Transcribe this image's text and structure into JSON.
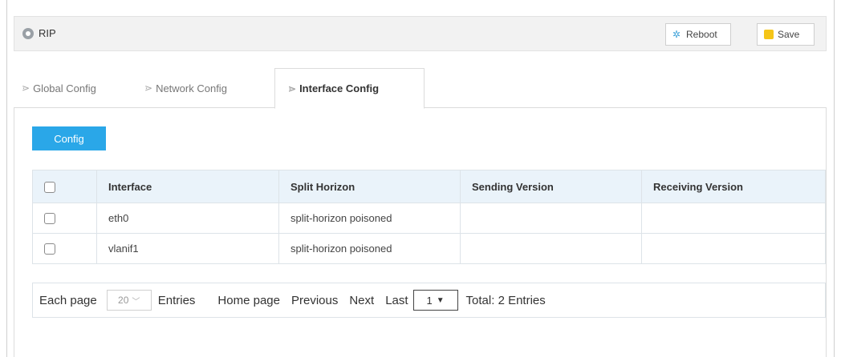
{
  "header": {
    "title": "RIP",
    "reboot_label": "Reboot",
    "save_label": "Save"
  },
  "tabs": [
    {
      "label": "Global Config",
      "active": false
    },
    {
      "label": "Network Config",
      "active": false
    },
    {
      "label": "Interface Config",
      "active": true
    }
  ],
  "toolbar": {
    "config_label": "Config"
  },
  "table": {
    "columns": [
      "Interface",
      "Split Horizon",
      "Sending Version",
      "Receiving Version"
    ],
    "rows": [
      {
        "interface": "eth0",
        "split_horizon": "split-horizon poisoned",
        "sending_version": "",
        "receiving_version": ""
      },
      {
        "interface": "vlanif1",
        "split_horizon": "split-horizon poisoned",
        "sending_version": "",
        "receiving_version": ""
      }
    ]
  },
  "pager": {
    "each_page_label": "Each page",
    "page_size": "20",
    "entries_label": "Entries",
    "home_label": "Home page",
    "previous_label": "Previous",
    "next_label": "Next",
    "last_label": "Last",
    "current_page": "1",
    "total_text": "Total: 2 Entries"
  },
  "colors": {
    "accent": "#2aa7e8",
    "header_bg": "#eaf3fa",
    "save_icon": "#f5c518"
  }
}
